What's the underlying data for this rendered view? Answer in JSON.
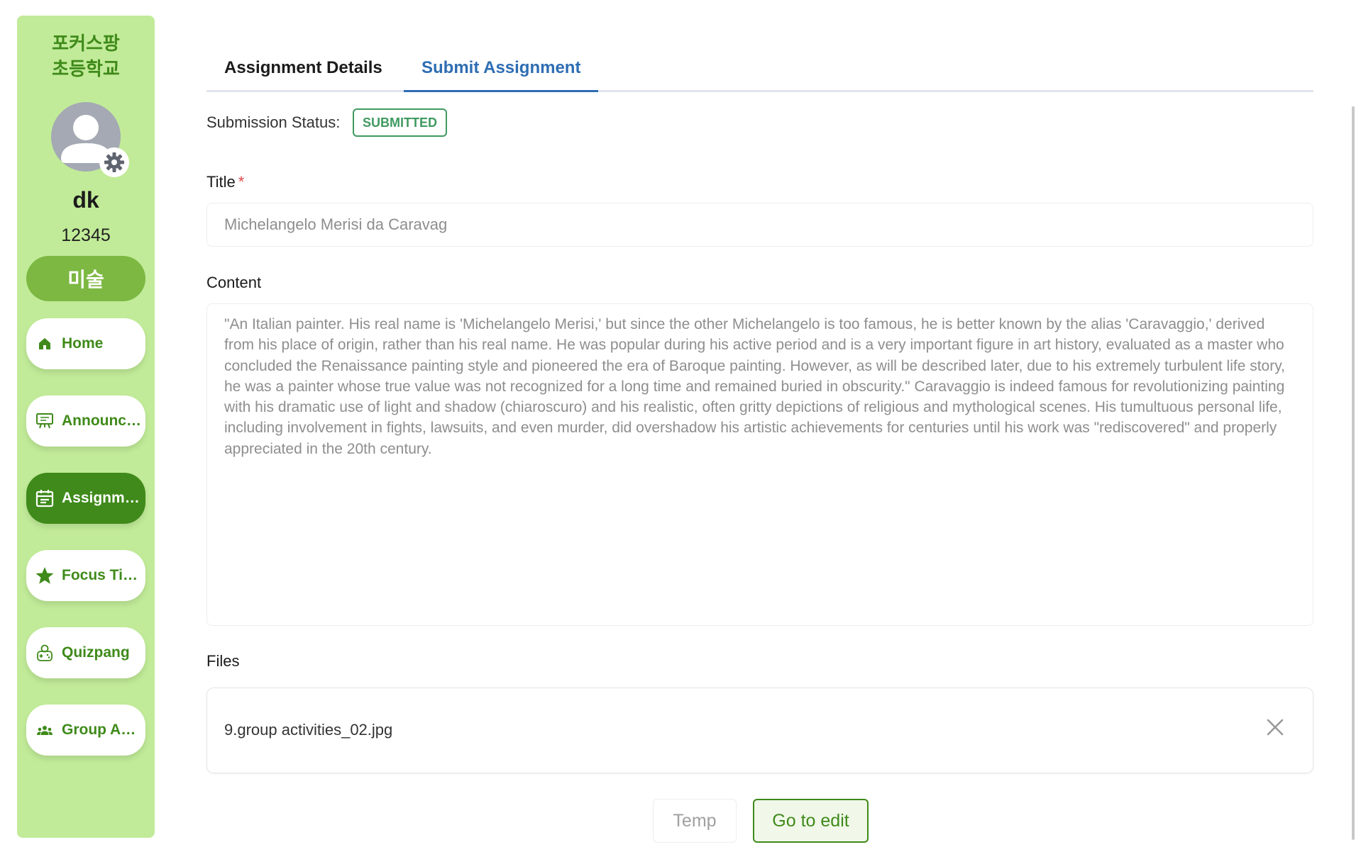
{
  "sidebar": {
    "school_line1": "포커스팡",
    "school_line2": "초등학교",
    "user_name": "dk",
    "user_id": "12345",
    "subject": "미술",
    "nav": [
      {
        "label": "Home",
        "icon": "home-icon"
      },
      {
        "label": "Announcements",
        "icon": "announcement-icon"
      },
      {
        "label": "Assignments",
        "icon": "calendar-icon",
        "active": true
      },
      {
        "label": "Focus Time",
        "icon": "star-icon"
      },
      {
        "label": "Quizpang",
        "icon": "gamepad-icon"
      },
      {
        "label": "Group Activities",
        "icon": "group-icon"
      }
    ]
  },
  "tabs": {
    "details": "Assignment Details",
    "submit": "Submit Assignment"
  },
  "status": {
    "label": "Submission Status:",
    "badge": "SUBMITTED"
  },
  "form": {
    "title_label": "Title",
    "title_required": "*",
    "title_value": "Michelangelo Merisi da Caravag",
    "content_label": "Content",
    "content_value": "\"An Italian painter. His real name is 'Michelangelo Merisi,' but since the other Michelangelo is too famous, he is better known by the alias 'Caravaggio,' derived from his place of origin, rather than his real name. He was popular during his active period and is a very important figure in art history, evaluated as a master who concluded the Renaissance painting style and pioneered the era of Baroque painting. However, as will be described later, due to his extremely turbulent life story, he was a painter whose true value was not recognized for a long time and remained buried in obscurity.\" Caravaggio is indeed famous for revolutionizing painting with his dramatic use of light and shadow (chiaroscuro) and his realistic, often gritty depictions of religious and mythological scenes. His tumultuous personal life, including involvement in fights, lawsuits, and even murder, did overshadow his artistic achievements for centuries until his work was \"rediscovered\" and properly appreciated in the 20th century.",
    "files_label": "Files",
    "files": [
      {
        "name": "9.group activities_02.jpg"
      }
    ]
  },
  "buttons": {
    "temp": "Temp",
    "edit": "Go to edit"
  },
  "colors": {
    "sidebar_bg": "#c1eb98",
    "brand_green": "#3f8a1a",
    "subject_green": "#7cb842",
    "tab_active": "#2e6db3",
    "status_green": "#3f9a5f"
  }
}
